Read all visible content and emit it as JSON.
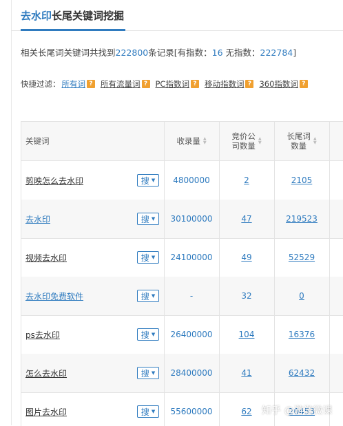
{
  "header": {
    "title_highlight": "去水印",
    "title_rest": "长尾关键词挖掘"
  },
  "summary": {
    "prefix": "相关长尾词关键词共找到",
    "total": "222800",
    "mid": "条记录[有指数：",
    "with_index": "16",
    "sep": " 无指数：",
    "no_index": "222784",
    "suffix": "]"
  },
  "filters": {
    "label": "快捷过滤：",
    "items": [
      {
        "label": "所有词",
        "active": true
      },
      {
        "label": "所有流量词",
        "active": false
      },
      {
        "label": "PC指数词",
        "active": false
      },
      {
        "label": "移动指数词",
        "active": false
      },
      {
        "label": "360指数词",
        "active": false
      }
    ],
    "help_glyph": "?"
  },
  "table": {
    "columns": {
      "keyword": "关键词",
      "indexed": "收录量",
      "bid_line1": "竞价公",
      "bid_line2": "司数量",
      "longtail_line1": "长尾词",
      "longtail_line2": "数量"
    },
    "search_button": "搜",
    "rows": [
      {
        "keyword": "剪映怎么去水印",
        "indexed": "4800000",
        "bid": "2",
        "longtail": "2105",
        "bid_link": true,
        "longtail_link": true
      },
      {
        "keyword": "去水印",
        "indexed": "30100000",
        "bid": "47",
        "longtail": "219523",
        "bid_link": true,
        "longtail_link": true
      },
      {
        "keyword": "视频去水印",
        "indexed": "24100000",
        "bid": "49",
        "longtail": "52529",
        "bid_link": true,
        "longtail_link": true
      },
      {
        "keyword": "去水印免费软件",
        "indexed": "-",
        "bid": "32",
        "longtail": "0",
        "bid_link": false,
        "longtail_link": true
      },
      {
        "keyword": "ps去水印",
        "indexed": "26400000",
        "bid": "104",
        "longtail": "16376",
        "bid_link": true,
        "longtail_link": true
      },
      {
        "keyword": "怎么去水印",
        "indexed": "28400000",
        "bid": "41",
        "longtail": "62432",
        "bid_link": true,
        "longtail_link": true
      },
      {
        "keyword": "图片去水印",
        "indexed": "55600000",
        "bid": "62",
        "longtail": "20453",
        "bid_link": true,
        "longtail_link": true
      }
    ]
  },
  "watermark": "知乎 @游游微课"
}
